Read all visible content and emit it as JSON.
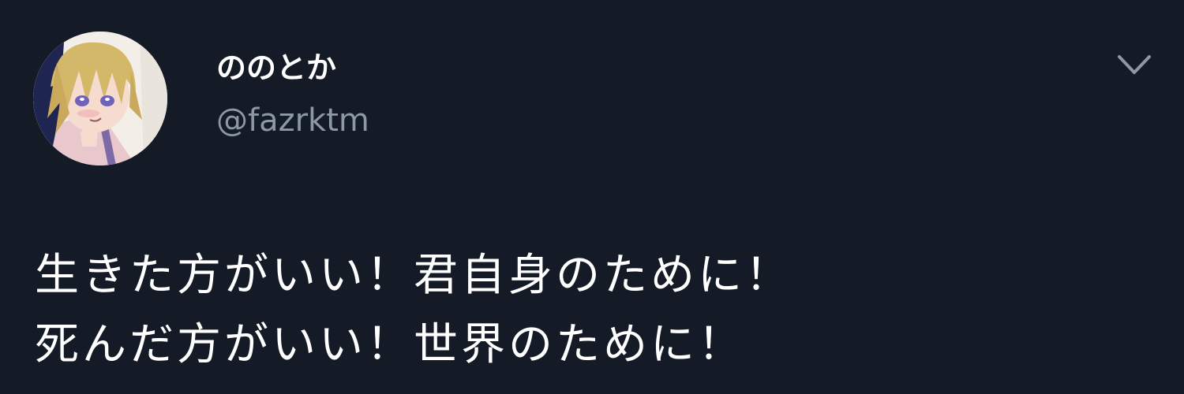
{
  "tweet": {
    "author": {
      "display_name": "ののとか",
      "handle": "@fazrktm",
      "avatar_icon": "anime-character-avatar"
    },
    "menu_icon": "chevron-down-icon",
    "text_lines": [
      "生きた方がいい！君自身のために！",
      "死んだ方がいい！世界のために！"
    ]
  },
  "colors": {
    "background": "#151b26",
    "primary_text": "#ffffff",
    "secondary_text": "#8b98a5"
  }
}
